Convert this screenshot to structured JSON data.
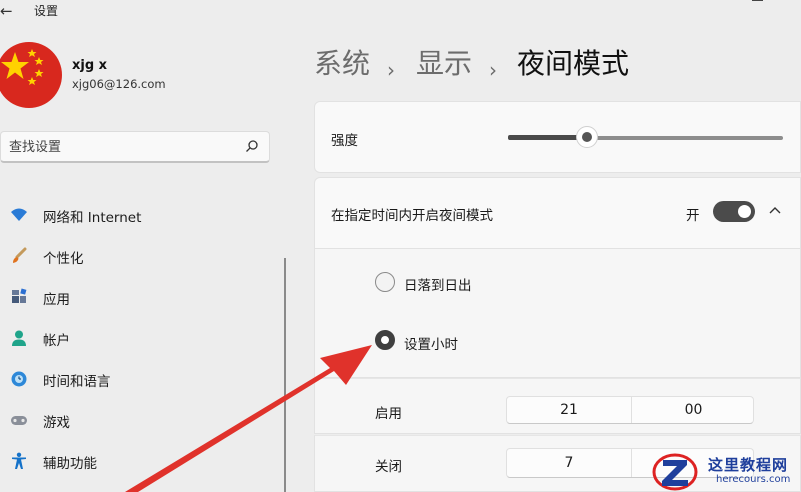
{
  "titlebar": {
    "title": "设置",
    "back_icon": "←"
  },
  "profile": {
    "name": "xjg x",
    "email": "xjg06@126.com"
  },
  "search": {
    "placeholder": "查找设置"
  },
  "nav": {
    "items": [
      {
        "label": "网络和 Internet",
        "icon": "wifi-icon"
      },
      {
        "label": "个性化",
        "icon": "brush-icon"
      },
      {
        "label": "应用",
        "icon": "apps-icon"
      },
      {
        "label": "帐户",
        "icon": "account-icon"
      },
      {
        "label": "时间和语言",
        "icon": "globe-clock-icon"
      },
      {
        "label": "游戏",
        "icon": "gamepad-icon"
      },
      {
        "label": "辅助功能",
        "icon": "accessibility-icon"
      }
    ]
  },
  "breadcrumb": {
    "level1": "系统",
    "level2": "显示",
    "current": "夜间模式",
    "separator": "›"
  },
  "strength": {
    "label": "强度",
    "value_fraction": 0.28
  },
  "schedule": {
    "label": "在指定时间内开启夜间模式",
    "toggle_state_text": "开",
    "toggle_on": true,
    "options": [
      {
        "label": "日落到日出",
        "selected": false
      },
      {
        "label": "设置小时",
        "selected": true
      }
    ],
    "turn_on": {
      "label": "启用",
      "hour": "21",
      "minute": "00"
    },
    "turn_off": {
      "label": "关闭",
      "hour": "7"
    }
  },
  "watermark": {
    "text": "这里教程网",
    "url": "herecours.com"
  },
  "colors": {
    "annotation_arrow": "#e0322b",
    "accent_dark": "#3f3f3f"
  }
}
